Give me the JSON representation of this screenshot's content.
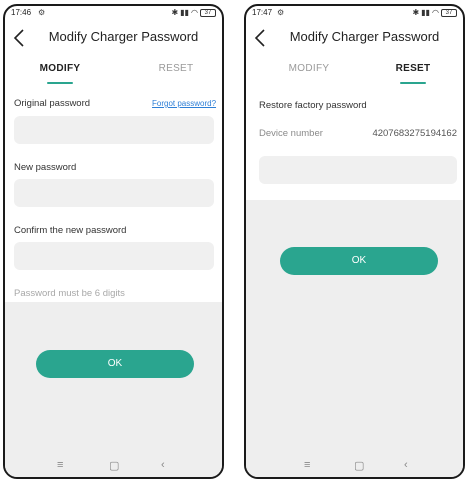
{
  "screens": [
    {
      "status_time": "17:46",
      "title": "Modify Charger Password",
      "tabs": [
        "MODIFY",
        "RESET"
      ],
      "original_label": "Original password",
      "forgot_link": "Forgot password?",
      "new_label": "New password",
      "confirm_label": "Confirm the new password",
      "hint": "Password must be 6 digits",
      "ok": "OK",
      "battery": "37"
    },
    {
      "status_time": "17:47",
      "title": "Modify Charger Password",
      "tabs": [
        "MODIFY",
        "RESET"
      ],
      "restore_label": "Restore factory password",
      "device_label": "Device number",
      "device_number": "4207683275194162",
      "ok": "OK",
      "battery": "37"
    }
  ],
  "colors": {
    "accent": "#2aa58f",
    "link": "#2e7fd6",
    "background_gray": "#eeeeee",
    "field": "#f0f0f0"
  },
  "icons": [
    "back-arrow-icon",
    "gear-icon",
    "bluetooth-icon",
    "signal-icon",
    "wifi-icon",
    "battery-icon",
    "menu-icon",
    "home-icon",
    "back-nav-icon"
  ]
}
